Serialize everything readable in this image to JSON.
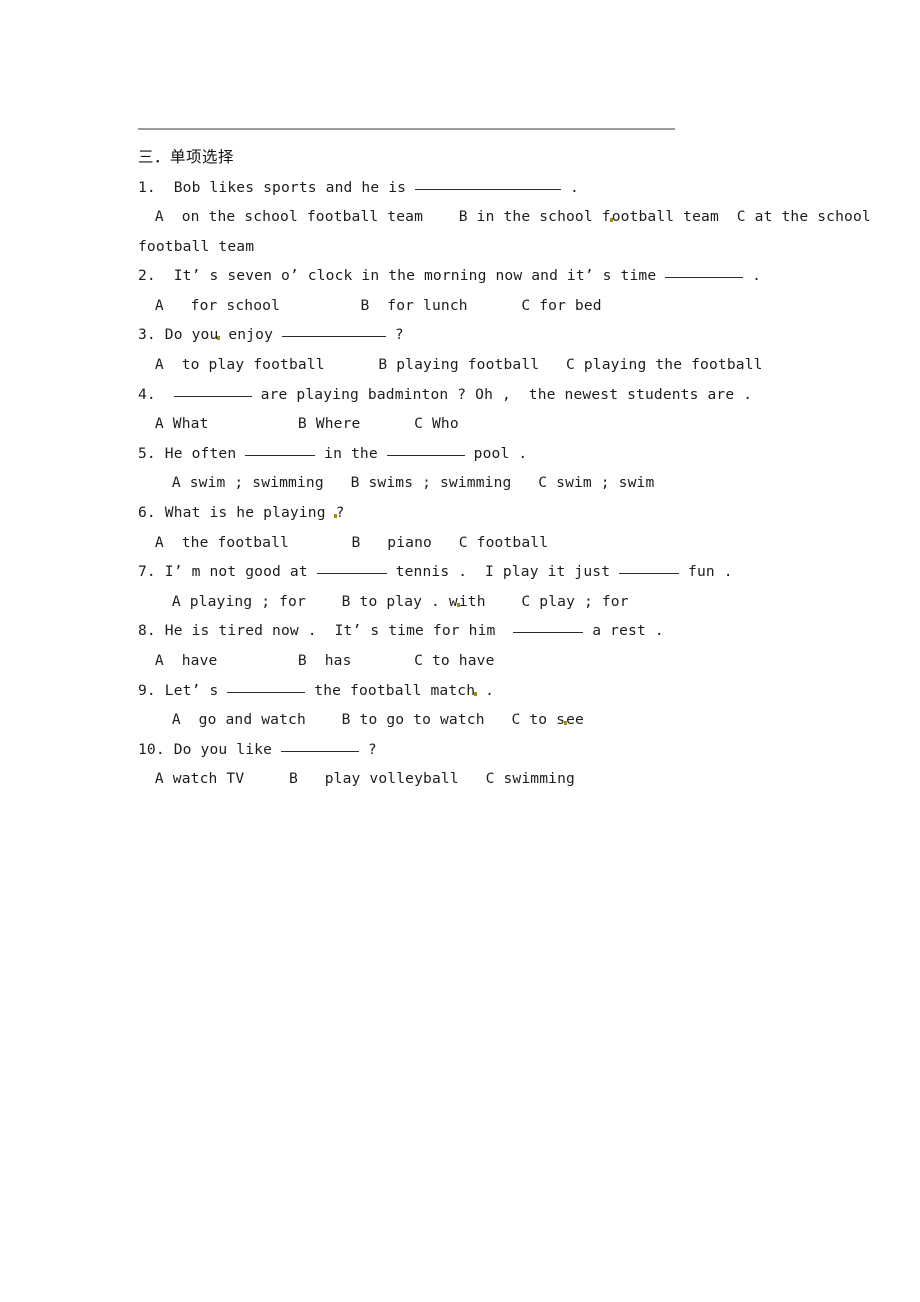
{
  "document": {
    "section_heading": "三．单项选择",
    "questions": [
      {
        "number": "1.",
        "stem_before": "1.  Bob likes sports and he is ",
        "blank": "xl",
        "stem_after": " .",
        "options_lines": [
          " A  on the school football team    B in the school f",
          "ootball team  C at the school",
          "football team"
        ],
        "option_a": "A  on the school football team",
        "option_b": "B in the school football team",
        "option_c": "C at the school football team"
      },
      {
        "number": "2.",
        "stem_before": "2.  It’ s seven o’ clock in the morning now and it’ s time ",
        "blank": "md",
        "stem_after": " .",
        "options_line": " A   for school         B  for lunch      C for bed",
        "option_a": "A   for school",
        "option_b": "B  for lunch",
        "option_c": "C for bed"
      },
      {
        "number": "3.",
        "stem_before": "3. Do you",
        "stem_mid": " enjoy ",
        "blank": "lg",
        "stem_after": " ?",
        "options_line": " A  to play football      B playing football   C playing the football",
        "option_a": "A  to play football",
        "option_b": "B playing football",
        "option_c": "C playing the football"
      },
      {
        "number": "4.",
        "stem_before": "4.  ",
        "blank": "md",
        "stem_after": " are playing badminton ? Oh ,  the newest students are .",
        "options_line": " A What          B Where      C Who",
        "option_a": "A What",
        "option_b": "B Where",
        "option_c": "C Who"
      },
      {
        "number": "5.",
        "stem_before": "5. He often ",
        "blank": "sm",
        "stem_mid": " in the ",
        "blank2": "md",
        "stem_after": " pool .",
        "options_line": "  A swim ; swimming   B swims ; swimming   C swim ; swim",
        "option_a": "A swim ; swimming",
        "option_b": "B swims ; swimming",
        "option_c": "C swim ; swim"
      },
      {
        "number": "6.",
        "stem_before": "6. What is he playing ",
        "stem_after": "?",
        "options_line": " A  the football       B   piano   C football",
        "option_a": "A  the football",
        "option_b": "B   piano",
        "option_c": "C football"
      },
      {
        "number": "7.",
        "stem_before": "7. I’ m not good at ",
        "blank": "sm",
        "stem_mid": " tennis .  I play it just ",
        "blank2": "xs",
        "stem_after": " fun .",
        "options_line_a": "  A playing ; for    B to play . w",
        "options_line_b": "ith    C play ; for",
        "option_a": "A playing ; for",
        "option_b": "B to play . with",
        "option_c": "C play ; for"
      },
      {
        "number": "8.",
        "stem_before": "8. He is tired now .  It’ s time for him  ",
        "blank": "sm",
        "stem_after": " a rest .",
        "options_line": " A  have         B  has       C to have",
        "option_a": "A  have",
        "option_b": "B  has",
        "option_c": "C to have"
      },
      {
        "number": "9.",
        "stem_before": "9. Let’ s ",
        "blank": "md",
        "stem_mid": " the football match",
        "stem_after": " .",
        "options_line_a": "  A  go and watch    B to go to watch   C to s",
        "options_line_b": "ee",
        "option_a": "A  go and watch",
        "option_b": "B to go to watch",
        "option_c": "C to see"
      },
      {
        "number": "10.",
        "stem_before": "10. Do you like ",
        "blank": "md",
        "stem_after": " ?",
        "options_line": " A watch TV     B   play volleyball   C swimming",
        "option_a": "A watch TV",
        "option_b": "B   play volleyball",
        "option_c": "C swimming"
      }
    ]
  },
  "colors": {
    "rule": "#9b9b9b",
    "text": "#1d1d1d",
    "artifact_mark": "#9a8c14",
    "background": "#ffffff"
  }
}
